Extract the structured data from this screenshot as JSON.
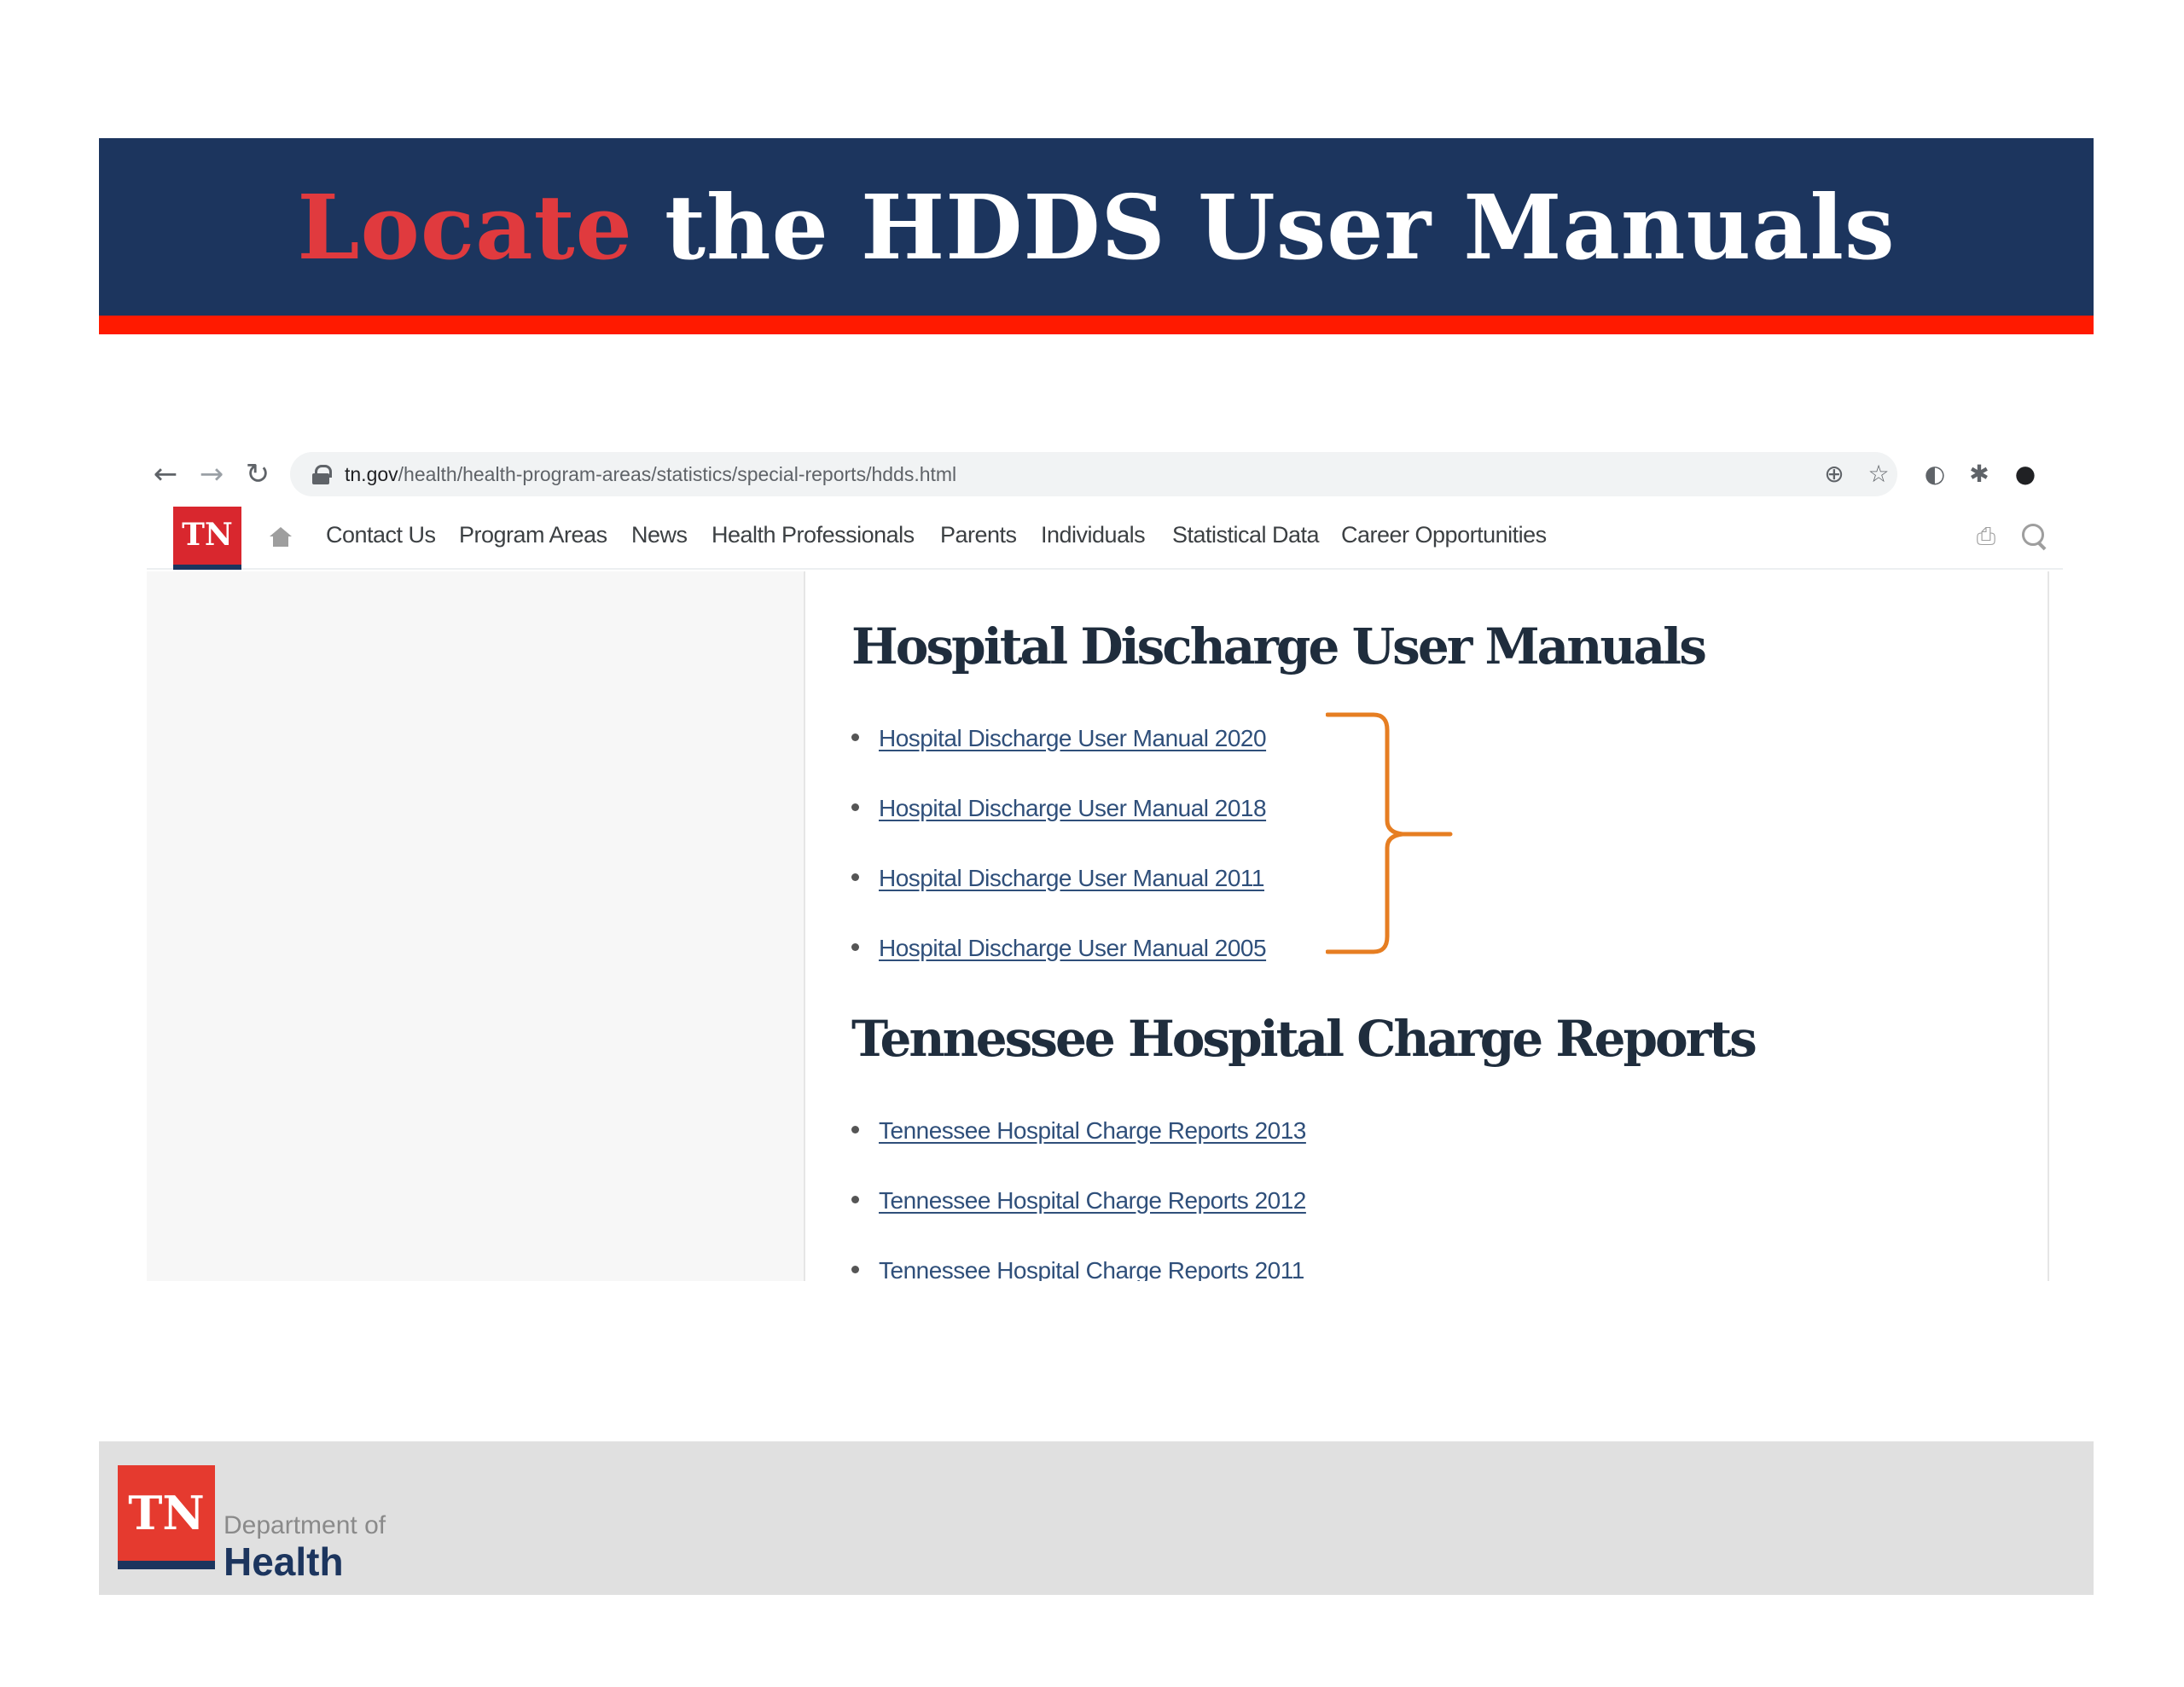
{
  "slide": {
    "title_accent": "Locate",
    "title_rest": " the HDDS User Manuals"
  },
  "browser": {
    "url_domain": "tn.gov",
    "url_path": "/health/health-program-areas/statistics/special-reports/hdds.html",
    "icons": [
      "back-icon",
      "forward-icon",
      "reload-icon",
      "lock-icon",
      "zoom-icon",
      "star-icon",
      "extension-icon",
      "puzzle-icon",
      "profile-icon"
    ]
  },
  "site_nav": {
    "logo": "TN",
    "links": [
      "Contact Us",
      "Program Areas",
      "News",
      "Health Professionals",
      "Parents",
      "Individuals",
      "Statistical Data",
      "Career Opportunities"
    ]
  },
  "content": {
    "manuals_heading": "Hospital Discharge User Manuals",
    "manuals": [
      "Hospital Discharge User Manual 2020",
      "Hospital Discharge User Manual 2018",
      "Hospital Discharge User Manual 2011",
      "Hospital Discharge User Manual 2005"
    ],
    "reports_heading": "Tennessee Hospital Charge Reports",
    "reports": [
      "Tennessee Hospital Charge Reports 2013",
      "Tennessee Hospital Charge Reports 2012",
      "Tennessee Hospital Charge Reports 2011"
    ]
  },
  "annotation": {
    "brace_color": "#e67e22"
  },
  "footer": {
    "logo": "TN",
    "dept_line": "Department of",
    "health_line": "Health"
  },
  "colors": {
    "banner": "#1c355e",
    "accent_red": "#e03a3e",
    "stripe": "#ff1a00"
  }
}
